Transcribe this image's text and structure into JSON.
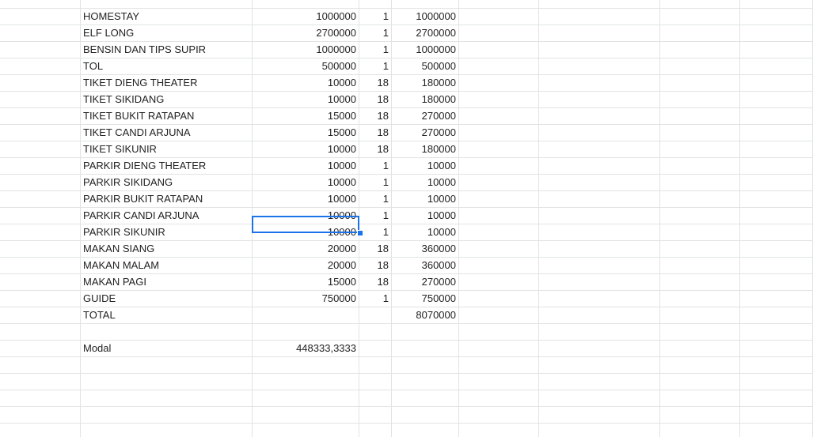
{
  "sheet": {
    "rows": [
      {
        "item": "HOMESTAY",
        "price": "1000000",
        "qty": "1",
        "subtotal": "1000000"
      },
      {
        "item": "ELF LONG",
        "price": "2700000",
        "qty": "1",
        "subtotal": "2700000"
      },
      {
        "item": "BENSIN DAN TIPS SUPIR",
        "price": "1000000",
        "qty": "1",
        "subtotal": "1000000"
      },
      {
        "item": "TOL",
        "price": "500000",
        "qty": "1",
        "subtotal": "500000"
      },
      {
        "item": "TIKET DIENG THEATER",
        "price": "10000",
        "qty": "18",
        "subtotal": "180000"
      },
      {
        "item": "TIKET SIKIDANG",
        "price": "10000",
        "qty": "18",
        "subtotal": "180000"
      },
      {
        "item": "TIKET BUKIT RATAPAN",
        "price": "15000",
        "qty": "18",
        "subtotal": "270000"
      },
      {
        "item": "TIKET CANDI ARJUNA",
        "price": "15000",
        "qty": "18",
        "subtotal": "270000"
      },
      {
        "item": "TIKET SIKUNIR",
        "price": "10000",
        "qty": "18",
        "subtotal": "180000"
      },
      {
        "item": "PARKIR DIENG THEATER",
        "price": "10000",
        "qty": "1",
        "subtotal": "10000"
      },
      {
        "item": "PARKIR SIKIDANG",
        "price": "10000",
        "qty": "1",
        "subtotal": "10000"
      },
      {
        "item": "PARKIR BUKIT RATAPAN",
        "price": "10000",
        "qty": "1",
        "subtotal": "10000"
      },
      {
        "item": "PARKIR CANDI ARJUNA",
        "price": "10000",
        "qty": "1",
        "subtotal": "10000"
      },
      {
        "item": "PARKIR SIKUNIR",
        "price": "10000",
        "qty": "1",
        "subtotal": "10000"
      },
      {
        "item": "MAKAN SIANG",
        "price": "20000",
        "qty": "18",
        "subtotal": "360000"
      },
      {
        "item": "MAKAN MALAM",
        "price": "20000",
        "qty": "18",
        "subtotal": "360000"
      },
      {
        "item": "MAKAN PAGI",
        "price": "15000",
        "qty": "18",
        "subtotal": "270000"
      },
      {
        "item": "GUIDE",
        "price": "750000",
        "qty": "1",
        "subtotal": "750000"
      },
      {
        "item": "TOTAL",
        "price": "",
        "qty": "",
        "subtotal": "8070000"
      },
      {
        "item": "",
        "price": "",
        "qty": "",
        "subtotal": ""
      },
      {
        "item": "Modal",
        "price": "448333,3333",
        "qty": "",
        "subtotal": ""
      },
      {
        "item": "",
        "price": "",
        "qty": "",
        "subtotal": ""
      },
      {
        "item": "",
        "price": "",
        "qty": "",
        "subtotal": ""
      },
      {
        "item": "",
        "price": "",
        "qty": "",
        "subtotal": ""
      },
      {
        "item": "",
        "price": "",
        "qty": "",
        "subtotal": ""
      },
      {
        "item": "",
        "price": "",
        "qty": "",
        "subtotal": ""
      }
    ]
  },
  "colors": {
    "gridline": "#e2e3e3",
    "selection": "#1a73e8",
    "text": "#222222"
  }
}
